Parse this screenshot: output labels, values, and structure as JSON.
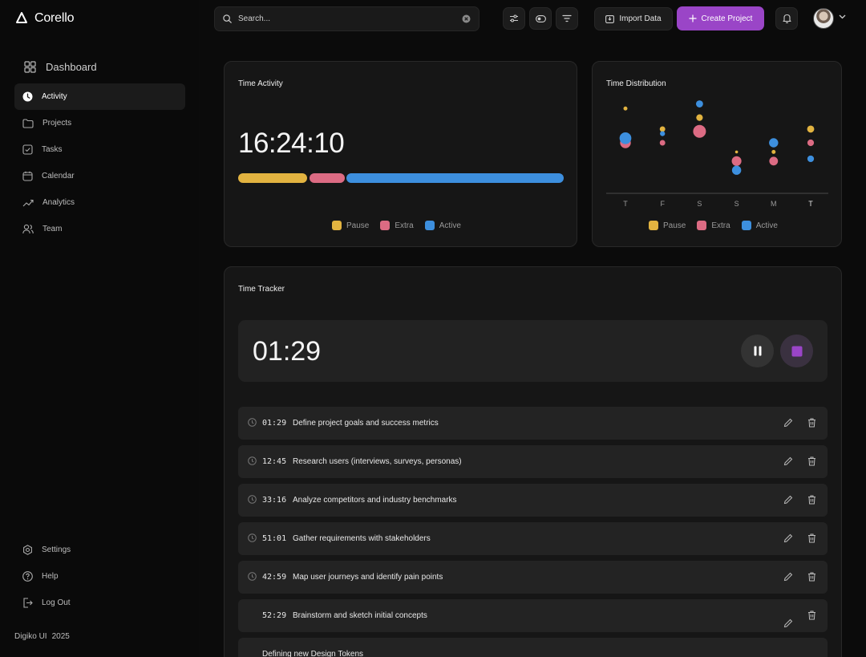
{
  "app": {
    "name": "Corello"
  },
  "sidebar": {
    "dashboard_label": "Dashboard",
    "items": [
      {
        "label": "Activity",
        "icon": "clock-icon",
        "active": true
      },
      {
        "label": "Projects",
        "icon": "folder-icon"
      },
      {
        "label": "Tasks",
        "icon": "checkbox-icon"
      },
      {
        "label": "Calendar",
        "icon": "calendar-icon"
      },
      {
        "label": "Analytics",
        "icon": "trend-icon"
      },
      {
        "label": "Team",
        "icon": "users-icon"
      }
    ],
    "bottom_items": [
      {
        "label": "Settings",
        "icon": "gear-icon"
      },
      {
        "label": "Help",
        "icon": "help-icon"
      },
      {
        "label": "Log Out",
        "icon": "logout-icon"
      }
    ],
    "footer": {
      "brand": "Digiko UI",
      "year": "2025"
    }
  },
  "topbar": {
    "search_placeholder": "Search...",
    "import_label": "Import Data",
    "create_label": "Create Project"
  },
  "time_activity": {
    "title": "Time Activity",
    "total": "16:24:10",
    "segments": [
      {
        "name": "Pause",
        "fraction": 0.21,
        "color": "#e2b340"
      },
      {
        "name": "Extra",
        "fraction": 0.11,
        "color": "#dc6b83"
      },
      {
        "name": "Active",
        "fraction": 0.68,
        "color": "#3d8fde"
      }
    ],
    "legend": [
      "Pause",
      "Extra",
      "Active"
    ]
  },
  "chart_data": {
    "type": "scatter",
    "title": "Time Distribution",
    "categories": [
      "T",
      "F",
      "S",
      "S",
      "M",
      "T"
    ],
    "series": [
      {
        "name": "Pause",
        "color": "#e2b340",
        "y": [
          3.5,
          2.6,
          3.1,
          1.6,
          1.6,
          2.6
        ],
        "size": [
          0.15,
          0.3,
          0.4,
          0.05,
          0.15,
          0.45
        ]
      },
      {
        "name": "Extra",
        "color": "#dc6b83",
        "y": [
          2.0,
          2.0,
          2.5,
          1.2,
          1.2,
          2.0
        ],
        "size": [
          0.8,
          0.3,
          1.0,
          0.7,
          0.6,
          0.4
        ]
      },
      {
        "name": "Active",
        "color": "#3d8fde",
        "y": [
          2.2,
          2.4,
          3.7,
          0.8,
          2.0,
          1.3
        ],
        "size": [
          0.9,
          0.25,
          0.45,
          0.65,
          0.65,
          0.4
        ]
      }
    ],
    "ylim": [
      0,
      4
    ],
    "legend": [
      "Pause",
      "Extra",
      "Active"
    ]
  },
  "tracker": {
    "title": "Time Tracker",
    "current": "01:29",
    "tasks": [
      {
        "time": "01:29",
        "title": "Define project goals and success metrics"
      },
      {
        "time": "12:45",
        "title": "Research users (interviews, surveys, personas)"
      },
      {
        "time": "33:16",
        "title": "Analyze competitors and industry benchmarks"
      },
      {
        "time": "51:01",
        "title": "Gather requirements with stakeholders"
      },
      {
        "time": "42:59",
        "title": "Map user journeys and identify pain points"
      },
      {
        "time": "52:29",
        "title": "Brainstorm and sketch initial concepts"
      },
      {
        "time": "",
        "title": "Defining new Design Tokens"
      }
    ]
  }
}
